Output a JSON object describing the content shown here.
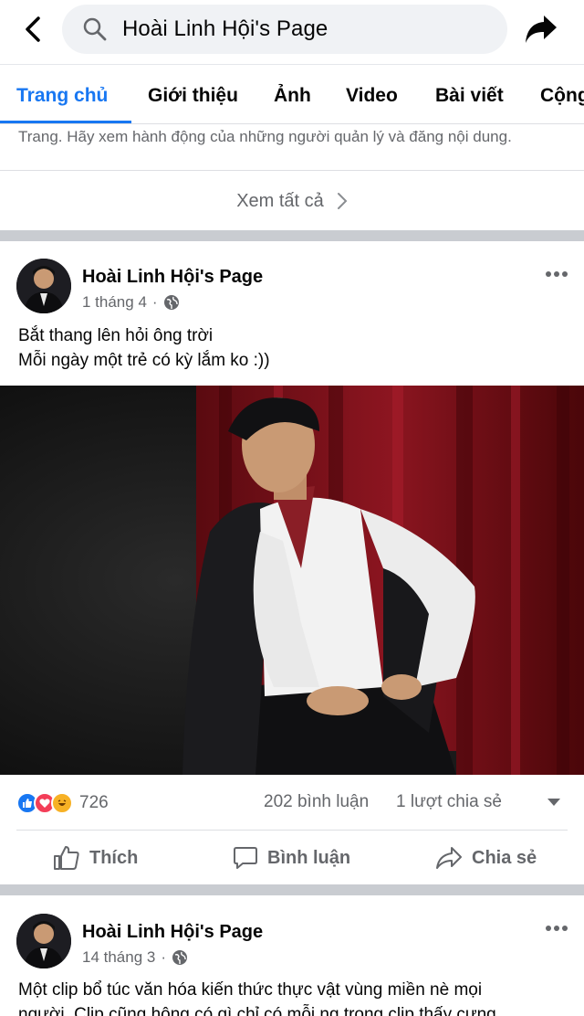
{
  "search": {
    "query": "Hoài Linh Hội's Page"
  },
  "tabs": [
    {
      "label": "Trang chủ",
      "active": true
    },
    {
      "label": "Giới thiệu"
    },
    {
      "label": "Ảnh"
    },
    {
      "label": "Video"
    },
    {
      "label": "Bài viết"
    },
    {
      "label": "Cộng đồng"
    }
  ],
  "transparency": {
    "text": "Trang. Hãy xem hành động của những người quản lý và đăng nội dung.",
    "see_all": "Xem tất cả"
  },
  "posts": [
    {
      "author": "Hoài Linh Hội's Page",
      "date": "1 tháng 4",
      "lines": [
        "Bắt thang lên hỏi ông trời",
        "Mỗi ngày một trẻ có kỳ lắm ko :))"
      ],
      "reaction_count": "726",
      "comments": "202 bình luận",
      "shares": "1 lượt chia sẻ"
    },
    {
      "author": "Hoài Linh Hội's Page",
      "date": "14 tháng 3",
      "lines": [
        "Một clip bổ túc văn hóa kiến thức thực vật vùng miền nè mọi",
        "người. Clip cũng hông có gì chỉ có mỗi ng trong clip thấy cưng"
      ]
    }
  ],
  "actions": {
    "like": "Thích",
    "comment": "Bình luận",
    "share": "Chia sẻ"
  },
  "colors": {
    "accent": "#1877f2",
    "secondary_text": "#65676b",
    "separator": "#c9ccd1"
  }
}
